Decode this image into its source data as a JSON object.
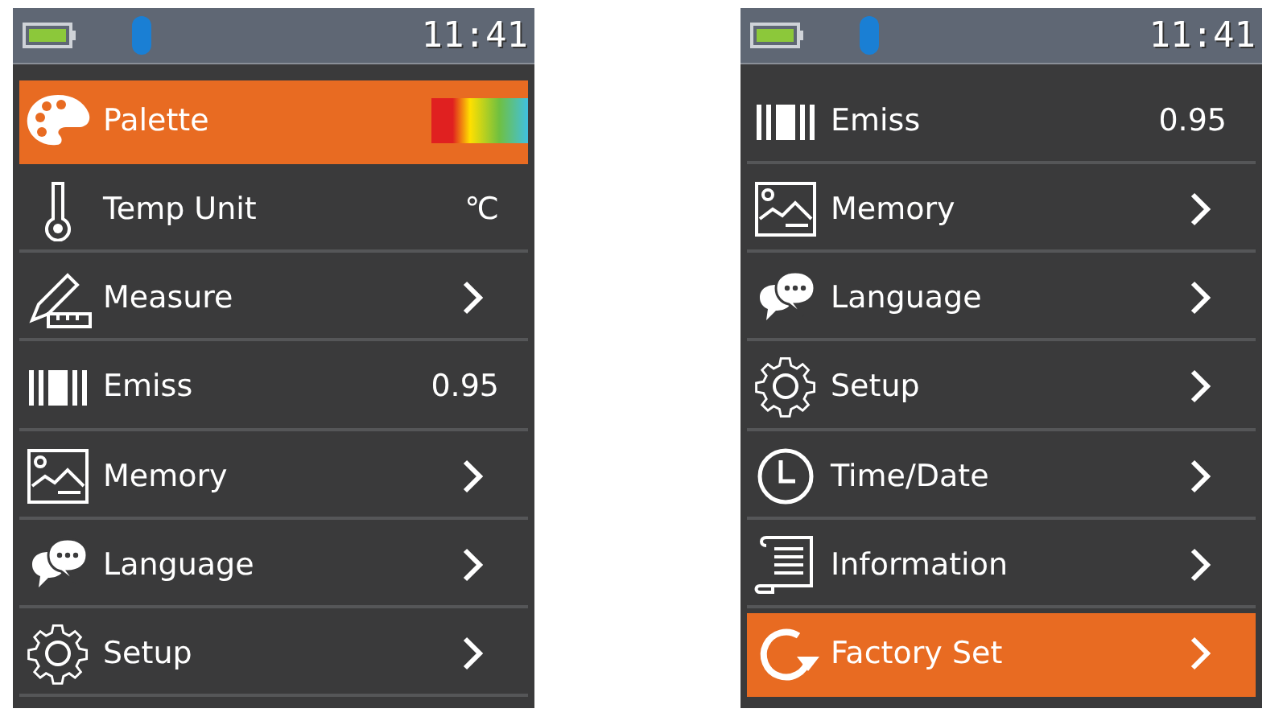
{
  "screens": [
    {
      "status_bar": {
        "time": "11:41"
      },
      "items": [
        {
          "kind": "palette",
          "label": "Palette",
          "selected": true,
          "trailing": {
            "kind": "gradient"
          }
        },
        {
          "kind": "thermometer",
          "label": "Temp Unit",
          "selected": false,
          "trailing": {
            "kind": "text",
            "value": "℃"
          }
        },
        {
          "kind": "pencil-ruler",
          "label": "Measure",
          "selected": false,
          "trailing": {
            "kind": "chevron"
          }
        },
        {
          "kind": "bars",
          "label": "Emiss",
          "selected": false,
          "trailing": {
            "kind": "text",
            "value": "0.95"
          }
        },
        {
          "kind": "image",
          "label": "Memory",
          "selected": false,
          "trailing": {
            "kind": "chevron"
          }
        },
        {
          "kind": "chat",
          "label": "Language",
          "selected": false,
          "trailing": {
            "kind": "chevron"
          }
        },
        {
          "kind": "gear",
          "label": "Setup",
          "selected": false,
          "trailing": {
            "kind": "chevron"
          }
        }
      ]
    },
    {
      "status_bar": {
        "time": "11:41"
      },
      "items": [
        {
          "kind": "bars",
          "label": "Emiss",
          "selected": false,
          "trailing": {
            "kind": "text",
            "value": "0.95"
          }
        },
        {
          "kind": "image",
          "label": "Memory",
          "selected": false,
          "trailing": {
            "kind": "chevron"
          }
        },
        {
          "kind": "chat",
          "label": "Language",
          "selected": false,
          "trailing": {
            "kind": "chevron"
          }
        },
        {
          "kind": "gear",
          "label": "Setup",
          "selected": false,
          "trailing": {
            "kind": "chevron"
          }
        },
        {
          "kind": "clock",
          "label": "Time/Date",
          "selected": false,
          "trailing": {
            "kind": "chevron"
          }
        },
        {
          "kind": "document",
          "label": "Information",
          "selected": false,
          "trailing": {
            "kind": "chevron"
          }
        },
        {
          "kind": "refresh",
          "label": "Factory Set",
          "selected": true,
          "trailing": {
            "kind": "chevron"
          }
        }
      ]
    }
  ]
}
